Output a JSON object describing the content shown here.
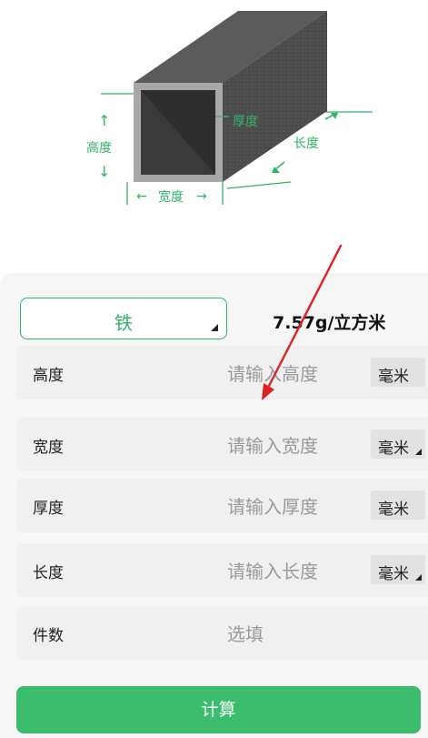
{
  "diagram": {
    "height_label": "高度",
    "width_label": "宽度",
    "thickness_label": "厚度",
    "length_label": "长度",
    "accent": "#2fb366"
  },
  "material": {
    "selected": "铁",
    "density": "7.57g/立方米"
  },
  "fields": [
    {
      "label": "高度",
      "placeholder": "请输入高度",
      "unit": "毫米",
      "unit_selectable": false
    },
    {
      "label": "宽度",
      "placeholder": "请输入宽度",
      "unit": "毫米",
      "unit_selectable": true
    },
    {
      "label": "厚度",
      "placeholder": "请输入厚度",
      "unit": "毫米",
      "unit_selectable": false
    },
    {
      "label": "长度",
      "placeholder": "请输入长度",
      "unit": "毫米",
      "unit_selectable": true
    },
    {
      "label": "件数",
      "placeholder": "选填"
    }
  ],
  "calculate_label": "计算",
  "colors": {
    "primary": "#3cbd6e",
    "annotation_arrow": "#e02020"
  }
}
